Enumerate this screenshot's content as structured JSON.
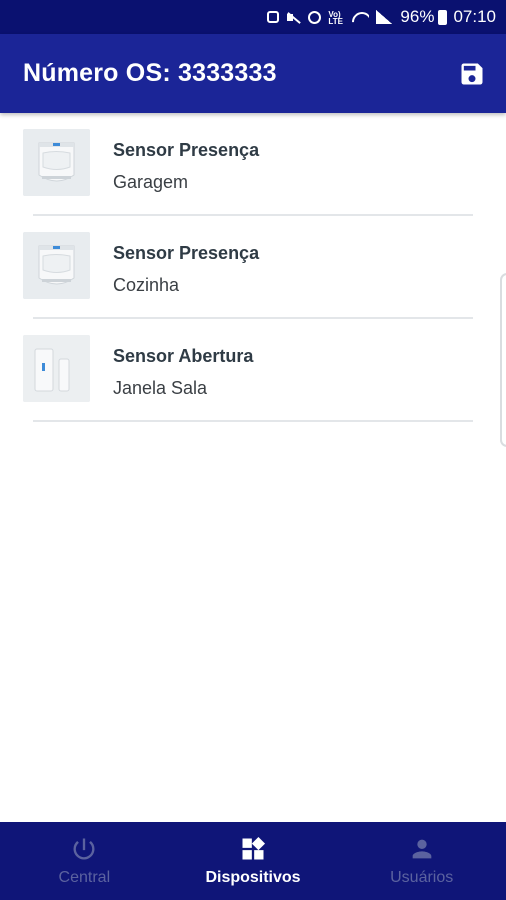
{
  "status_bar": {
    "battery": "96%",
    "time": "07:10",
    "volte": "Vo) LTE",
    "icons": [
      "lock-icon",
      "mute-icon",
      "alarm-icon",
      "volte-icon",
      "wifi-icon",
      "signal-icon",
      "battery-icon"
    ]
  },
  "app_bar": {
    "title": "Número OS: 3333333",
    "action_icon": "save-icon"
  },
  "devices": [
    {
      "name": "Sensor Presença",
      "location": "Garagem",
      "image": "presence-sensor"
    },
    {
      "name": "Sensor Presença",
      "location": "Cozinha",
      "image": "presence-sensor"
    },
    {
      "name": "Sensor Abertura",
      "location": "Janela Sala",
      "image": "opening-sensor"
    }
  ],
  "bottom_nav": {
    "tabs": [
      {
        "label": "Central",
        "icon": "power-icon",
        "active": false
      },
      {
        "label": "Dispositivos",
        "icon": "devices-icon",
        "active": true
      },
      {
        "label": "Usuários",
        "icon": "user-icon",
        "active": false
      }
    ]
  },
  "colors": {
    "status_bar": "#0a1170",
    "app_bar": "#1b2597",
    "bottom_nav": "#0f1578",
    "inactive_tab": "#5b629f",
    "active_tab": "#ffffff"
  }
}
